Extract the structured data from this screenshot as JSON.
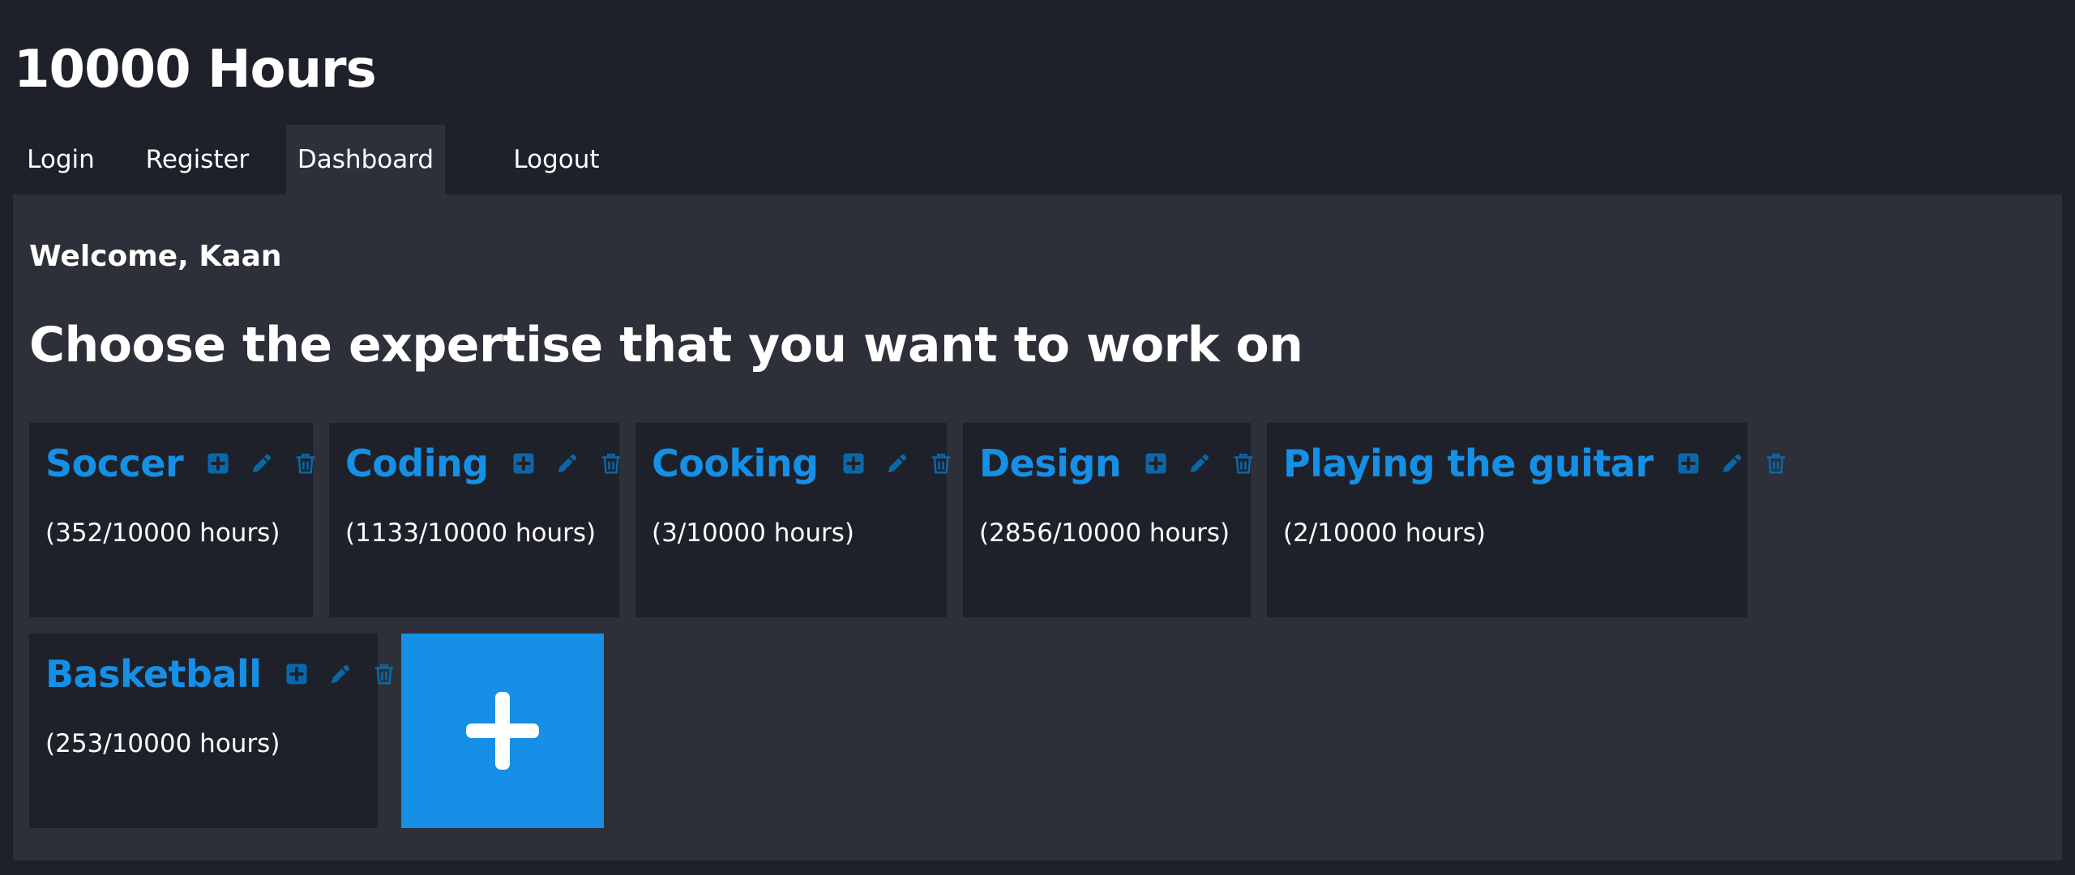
{
  "app": {
    "title": "10000 Hours"
  },
  "nav": {
    "items": [
      {
        "label": "Login"
      },
      {
        "label": "Register"
      },
      {
        "label": "Dashboard",
        "active": true
      },
      {
        "label": "Logout"
      }
    ]
  },
  "dashboard": {
    "welcome": "Welcome, Kaan",
    "heading": "Choose the expertise that you want to work on",
    "accent_color": "#1590e6",
    "expertises": [
      {
        "name": "Soccer",
        "hours": "(352/10000 hours)",
        "icons": [
          "plus-square-icon",
          "pencil-icon",
          "trash-icon"
        ]
      },
      {
        "name": "Coding",
        "hours": "(1133/10000 hours)",
        "icons": [
          "plus-square-icon",
          "pencil-icon",
          "trash-icon"
        ]
      },
      {
        "name": "Cooking",
        "hours": "(3/10000 hours)",
        "icons": [
          "plus-square-icon",
          "pencil-icon",
          "trash-icon"
        ]
      },
      {
        "name": "Design",
        "hours": "(2856/10000 hours)",
        "icons": [
          "plus-square-icon",
          "pencil-icon",
          "trash-icon"
        ]
      },
      {
        "name": "Playing the guitar",
        "hours": "(2/10000 hours)",
        "icons": [
          "plus-square-icon",
          "pencil-icon",
          "trash-icon"
        ]
      },
      {
        "name": "Basketball",
        "hours": "(253/10000 hours)",
        "icons": [
          "plus-square-icon",
          "pencil-icon",
          "trash-icon"
        ]
      }
    ],
    "add_tile_icon": "plus-icon"
  }
}
